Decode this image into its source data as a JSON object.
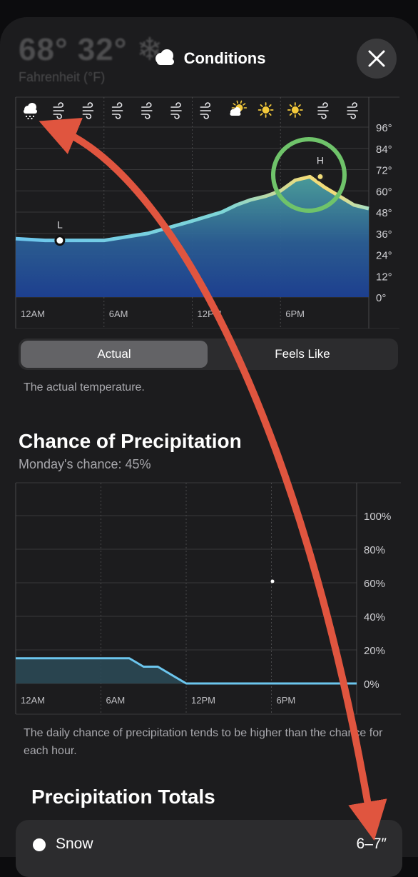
{
  "header": {
    "title": "Conditions",
    "background_temps": "68° 32° ❄",
    "background_unit": "Fahrenheit (°F)",
    "close_label": "Close"
  },
  "temperature_chart": {
    "condition_icons": [
      "cloud-snow-icon",
      "wind-icon",
      "wind-icon",
      "wind-icon",
      "wind-icon",
      "wind-icon",
      "wind-icon",
      "partly-sunny-icon",
      "sun-icon",
      "sun-icon",
      "wind-icon",
      "wind-icon"
    ],
    "low_label": "L",
    "high_label": "H"
  },
  "segmented": {
    "options": [
      "Actual",
      "Feels Like"
    ],
    "selected": "Actual"
  },
  "actual_description": "The actual temperature.",
  "precipitation": {
    "title": "Chance of Precipitation",
    "subtitle": "Monday's chance: 45%",
    "note": "The daily chance of precipitation tends to be higher than the chance for each hour."
  },
  "totals": {
    "title": "Precipitation Totals",
    "items": [
      {
        "label": "Snow",
        "value": "6–7″"
      }
    ]
  },
  "chart_data": [
    {
      "type": "area",
      "x_ticks": [
        "12AM",
        "6AM",
        "12PM",
        "6PM"
      ],
      "y_ticks": [
        "96°",
        "84°",
        "72°",
        "60°",
        "48°",
        "36°",
        "24°",
        "12°",
        "0°"
      ],
      "ylim": [
        0,
        96
      ],
      "x": [
        0,
        2,
        3,
        6,
        9,
        12,
        14,
        15,
        16,
        17,
        18,
        19,
        20,
        21,
        22,
        23,
        24
      ],
      "values": [
        33,
        32,
        32,
        32,
        36,
        43,
        48,
        52,
        55,
        57,
        60,
        66,
        68,
        62,
        57,
        52,
        50
      ],
      "low": {
        "x": 3,
        "value": 32
      },
      "high": {
        "x": 20.7,
        "value": 68
      },
      "grid": true
    },
    {
      "type": "area",
      "x_ticks": [
        "12AM",
        "6AM",
        "12PM",
        "6PM"
      ],
      "y_ticks": [
        "100%",
        "80%",
        "60%",
        "40%",
        "20%",
        "0%"
      ],
      "ylim": [
        0,
        100
      ],
      "x": [
        0,
        8,
        9,
        10,
        12,
        24
      ],
      "values": [
        15,
        15,
        10,
        10,
        0,
        0
      ],
      "grid": true
    }
  ],
  "colors": {
    "annotation_arrow": "#e0553f",
    "highlight_circle": "#6fc36a",
    "temp_line_cold": "#6cc6ee",
    "temp_line_warm": "#f1dc7a",
    "precip_line": "#6cc6ee"
  }
}
